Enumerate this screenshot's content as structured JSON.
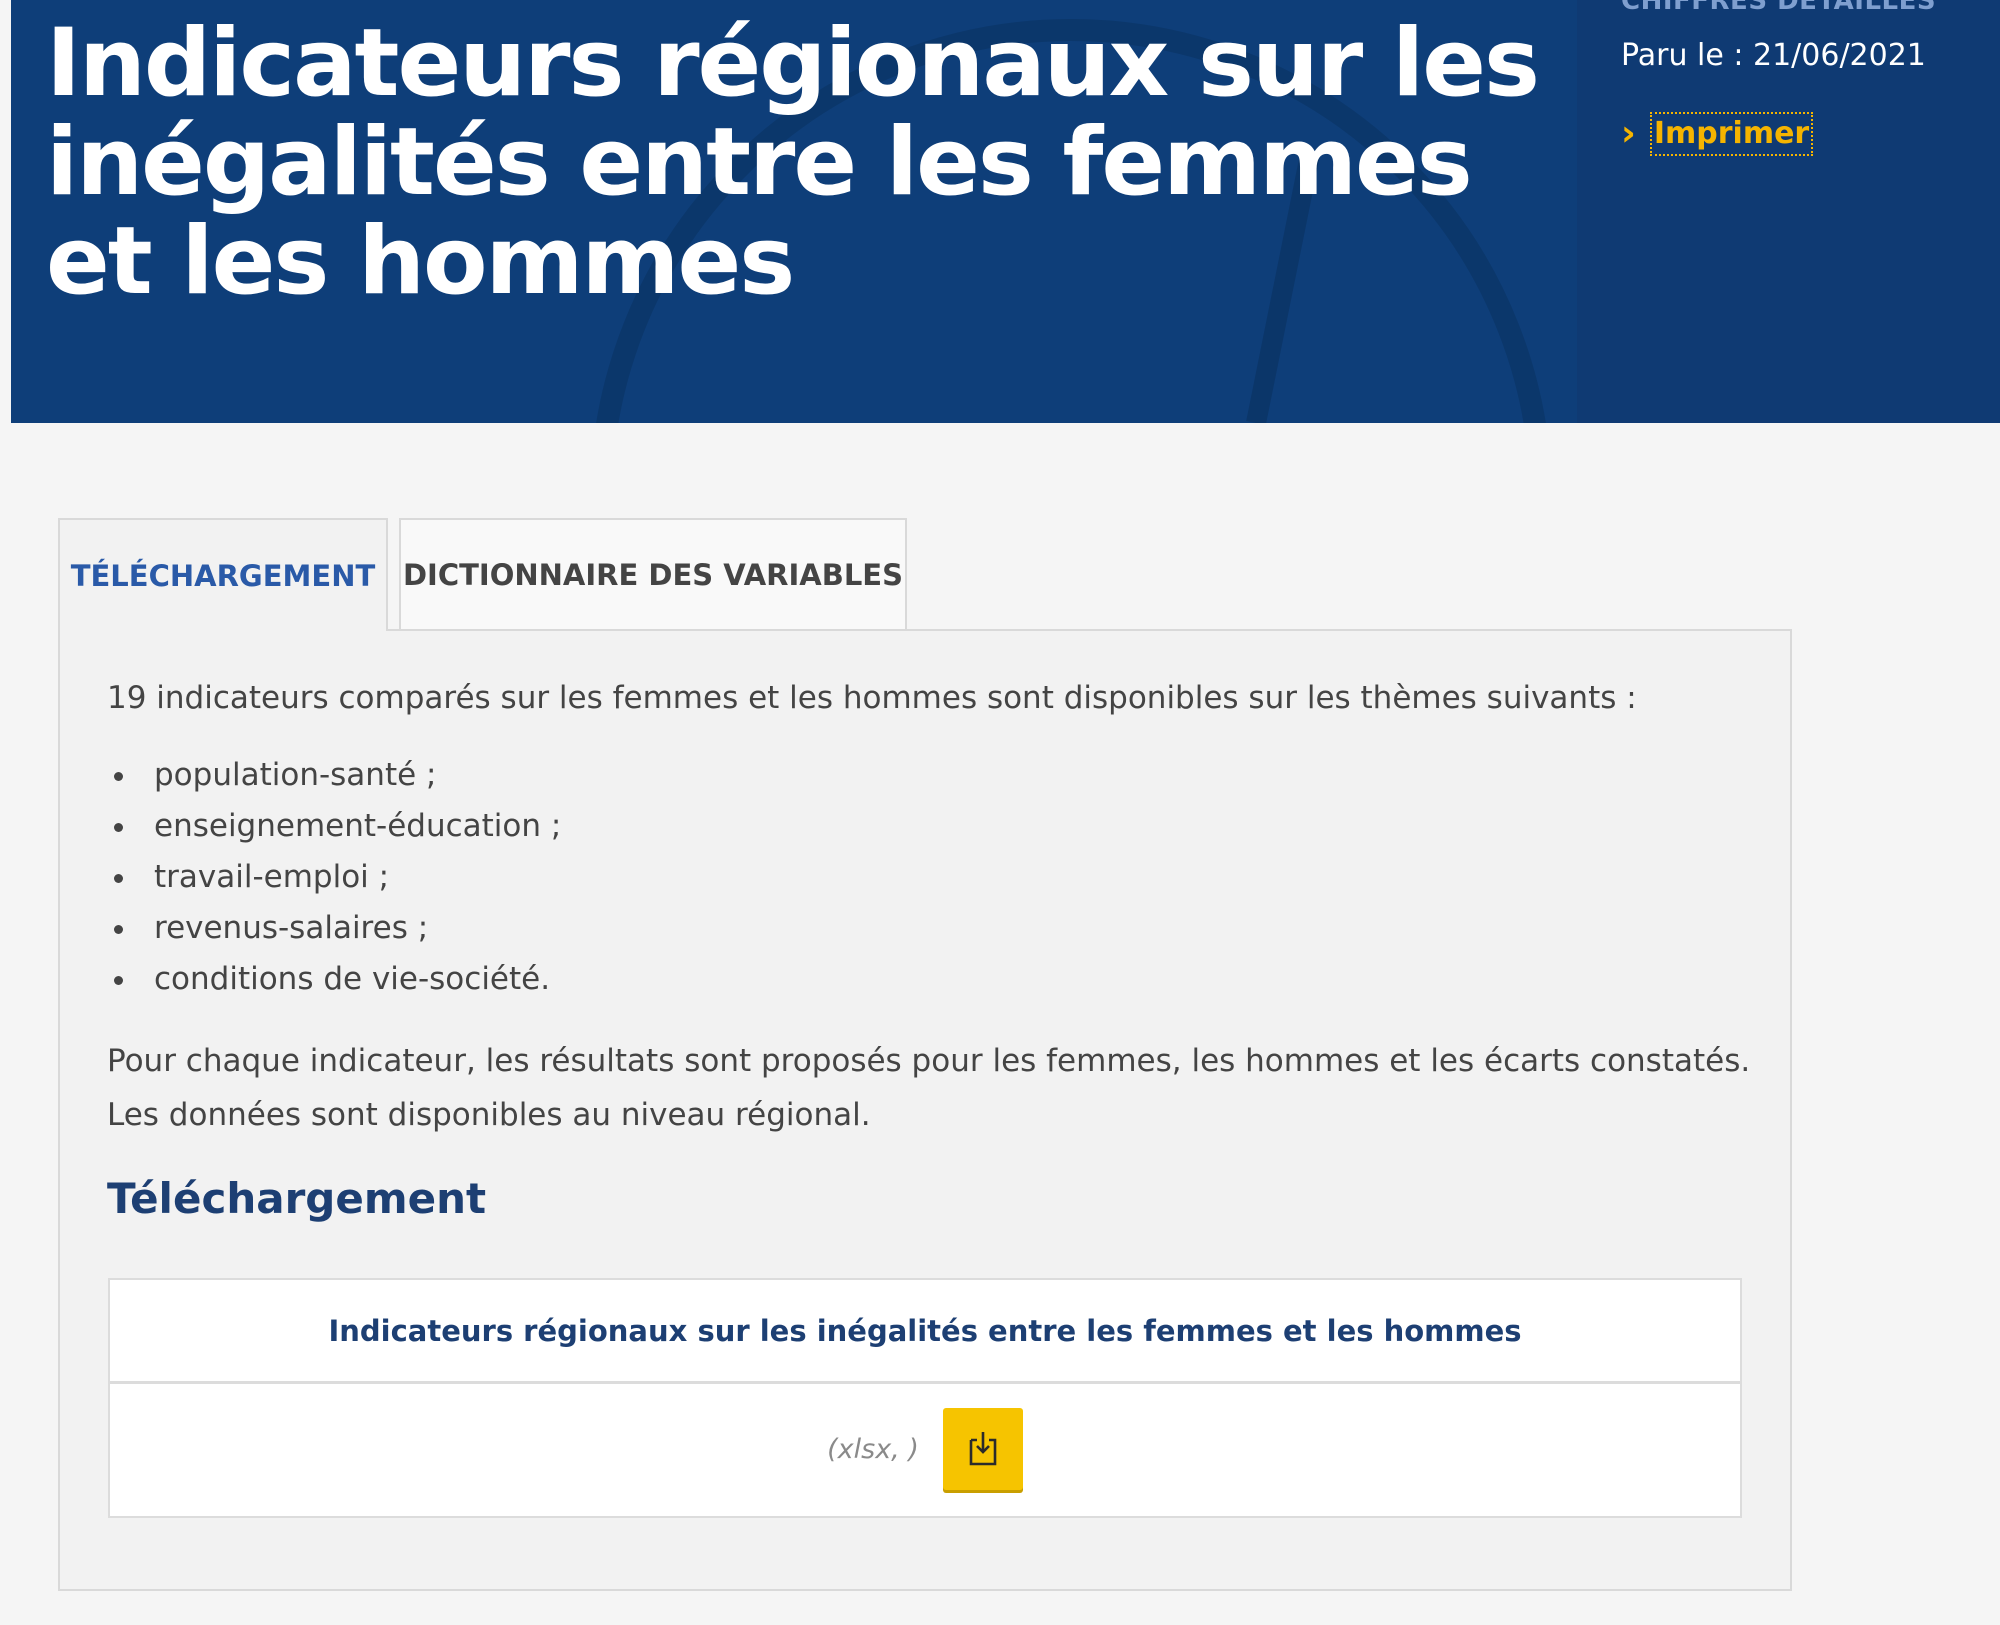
{
  "header": {
    "category": "CHIFFRES DÉTAILLÉS",
    "title": "Indicateurs régionaux sur les inégalités entre les femmes et les hommes",
    "publication_date": "Paru le : 21/06/2021",
    "print_label": "Imprimer"
  },
  "tabs": [
    {
      "label": "TÉLÉCHARGEMENT",
      "active": true
    },
    {
      "label": "DICTIONNAIRE DES VARIABLES",
      "active": false
    }
  ],
  "content": {
    "intro": "19 indicateurs comparés sur les femmes et les hommes sont disponibles sur les thèmes suivants :",
    "themes": [
      "population-santé ;",
      "enseignement-éducation ;",
      "travail-emploi ;",
      "revenus-salaires ;",
      "conditions de vie-société."
    ],
    "paragraph": "Pour chaque indicateur, les résultats sont proposés pour les femmes, les hommes et les écarts constatés. Les données sont disponibles au niveau régional.",
    "section_heading": "Téléchargement",
    "download_table": {
      "header": "Indicateurs régionaux sur les inégalités entre les femmes et les hommes",
      "file_format": "(xlsx, )",
      "button_icon": "download-icon"
    }
  },
  "colors": {
    "banner": "#0e3e79",
    "accent": "#f5b400",
    "tab_active_text": "#2a5aa8",
    "heading": "#1d3f73"
  }
}
